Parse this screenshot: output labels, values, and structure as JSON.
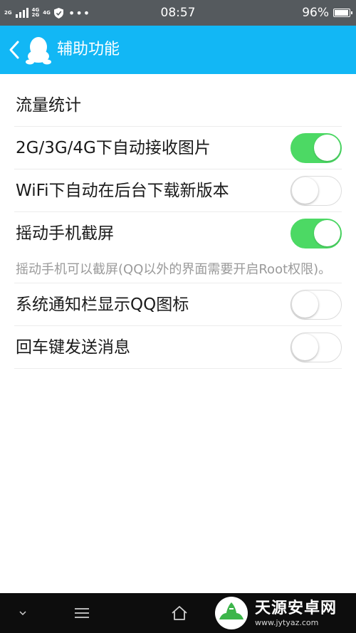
{
  "status_bar": {
    "net_tag_top": "2G",
    "net_tag_2_top": "4G",
    "net_tag_2_bottom": "2G",
    "net_tag_3_top": "4G",
    "time": "08:57",
    "battery": "96%",
    "battery_level": 0.96
  },
  "header": {
    "title": "辅助功能",
    "color": "#12b7f5"
  },
  "settings": {
    "traffic_stats": "流量统计",
    "auto_receive_images": {
      "label": "2G/3G/4G下自动接收图片",
      "on": true
    },
    "wifi_background_download": {
      "label": "WiFi下自动在后台下载新版本",
      "on": false
    },
    "shake_screenshot": {
      "label": "摇动手机截屏",
      "on": true
    },
    "shake_hint": "摇动手机可以截屏(QQ以外的界面需要开启Root权限)。",
    "notification_bar_icon": {
      "label": "系统通知栏显示QQ图标",
      "on": false
    },
    "enter_key_send": {
      "label": "回车键发送消息",
      "on": false
    }
  },
  "watermark": {
    "name": "天源安卓网",
    "url": "www.jytyaz.com"
  },
  "colors": {
    "toggle_on": "#4cd964",
    "toggle_off_border": "#dcdcdc",
    "status_bar": "#555a5e"
  }
}
